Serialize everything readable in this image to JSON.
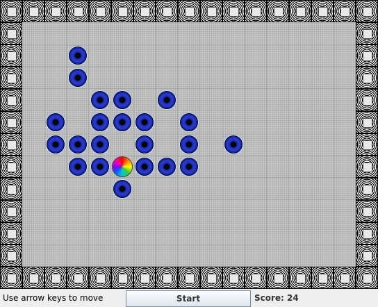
{
  "game": {
    "board_columns": 17,
    "board_rows": 13,
    "balls": [
      [
        3,
        2
      ],
      [
        3,
        3
      ],
      [
        4,
        4
      ],
      [
        5,
        4
      ],
      [
        7,
        4
      ],
      [
        2,
        5
      ],
      [
        4,
        5
      ],
      [
        5,
        5
      ],
      [
        6,
        5
      ],
      [
        8,
        5
      ],
      [
        2,
        6
      ],
      [
        3,
        6
      ],
      [
        4,
        6
      ],
      [
        6,
        6
      ],
      [
        8,
        6
      ],
      [
        10,
        6
      ],
      [
        3,
        7
      ],
      [
        4,
        7
      ],
      [
        6,
        7
      ],
      [
        7,
        7
      ],
      [
        8,
        7
      ],
      [
        5,
        8
      ]
    ],
    "player": [
      5,
      7
    ],
    "colors": {
      "ball": "#2040d8",
      "floor": "#c0c0c0",
      "wall": "#000000"
    }
  },
  "status": {
    "hint": "Use arrow keys to move",
    "start_label": "Start",
    "score_text": "Score: 24"
  }
}
